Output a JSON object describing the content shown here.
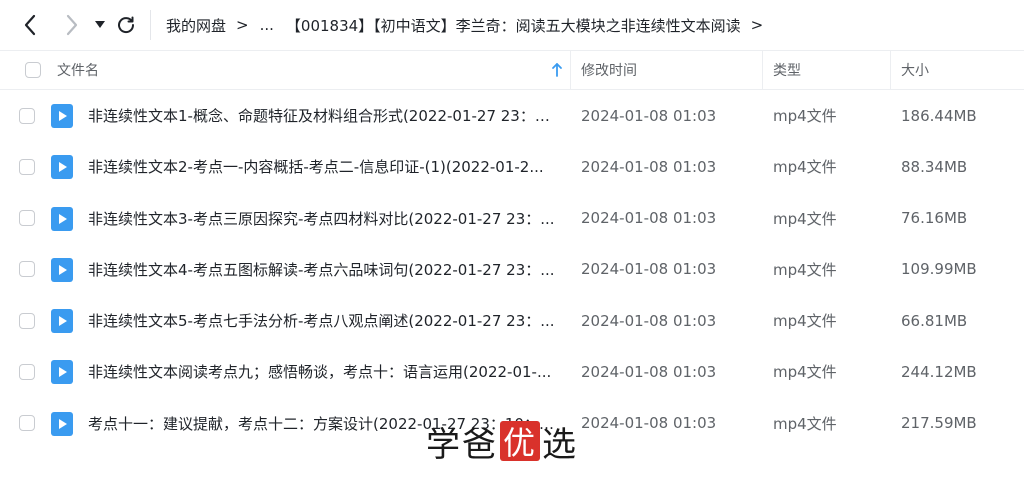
{
  "toolbar": {
    "back_icon": "chevron-left-icon",
    "forward_icon": "chevron-right-icon",
    "dropdown_icon": "caret-down-icon",
    "refresh_icon": "refresh-icon"
  },
  "breadcrumb": {
    "root": "我的网盘",
    "ellipsis": "...",
    "current": "【001834】【初中语文】李兰奇：阅读五大模块之非连续性文本阅读",
    "sep": ">"
  },
  "table": {
    "columns": {
      "name": "文件名",
      "modified": "修改时间",
      "type": "类型",
      "size": "大小"
    },
    "rows": [
      {
        "name": "非连续性文本1-概念、命题特征及材料组合形式(2022-01-27 23：0...",
        "modified": "2024-01-08 01:03",
        "type": "mp4文件",
        "size": "186.44MB"
      },
      {
        "name": "非连续性文本2-考点一-内容概括-考点二-信息印证-(1)(2022-01-2...",
        "modified": "2024-01-08 01:03",
        "type": "mp4文件",
        "size": "88.34MB"
      },
      {
        "name": "非连续性文本3-考点三原因探究-考点四材料对比(2022-01-27 23：...",
        "modified": "2024-01-08 01:03",
        "type": "mp4文件",
        "size": "76.16MB"
      },
      {
        "name": "非连续性文本4-考点五图标解读-考点六品味词句(2022-01-27 23：...",
        "modified": "2024-01-08 01:03",
        "type": "mp4文件",
        "size": "109.99MB"
      },
      {
        "name": "非连续性文本5-考点七手法分析-考点八观点阐述(2022-01-27 23：...",
        "modified": "2024-01-08 01:03",
        "type": "mp4文件",
        "size": "66.81MB"
      },
      {
        "name": "非连续性文本阅读考点九；感悟畅谈，考点十：语言运用(2022-01-...",
        "modified": "2024-01-08 01:03",
        "type": "mp4文件",
        "size": "244.12MB"
      },
      {
        "name": "考点十一：建议提献，考点十二：方案设计(2022-01-27 23：10：0...",
        "modified": "2024-01-08 01:03",
        "type": "mp4文件",
        "size": "217.59MB"
      }
    ]
  },
  "watermark": {
    "c1": "学",
    "c2": "爸",
    "c3": "优",
    "c4": "选",
    "highlight_color": "#d9322b"
  },
  "colors": {
    "video_icon": "#3a9bf0",
    "accent": "#1677ff"
  }
}
